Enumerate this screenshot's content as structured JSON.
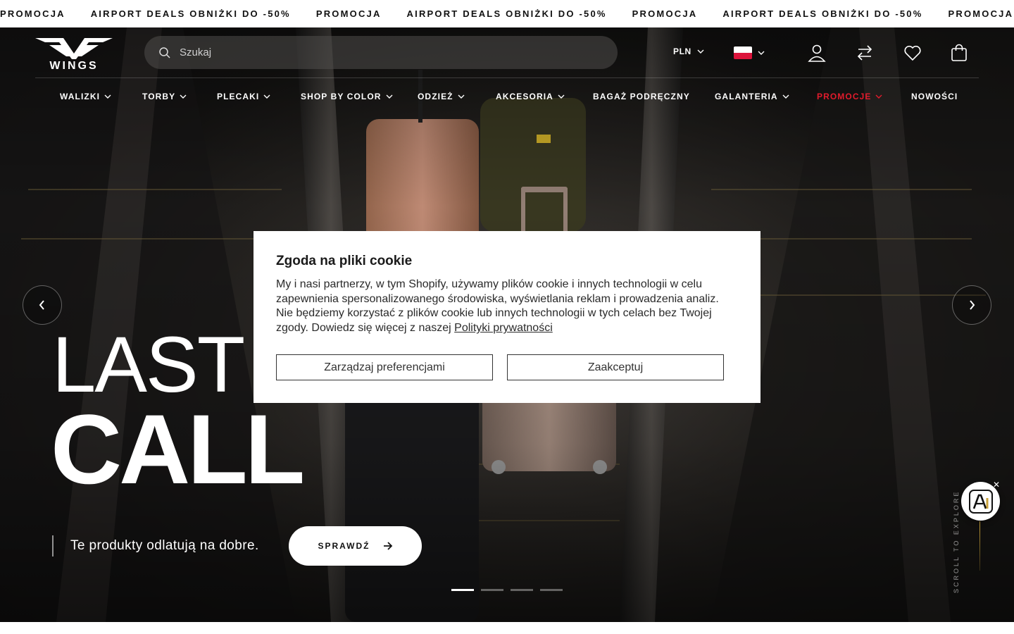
{
  "ticker": {
    "items": [
      "PROMOCJA",
      "AIRPORT DEALS OBNIŻKI DO -50%",
      "PROMOCJA",
      "AIRPORT DEALS OBNIŻKI DO -50%",
      "PROMOCJA",
      "AIRPORT DEALS OBNIŻKI DO -50%",
      "PROMOCJA"
    ]
  },
  "header": {
    "logo_text": "WINGS",
    "search_placeholder": "Szukaj",
    "currency": "PLN",
    "language_flag": "poland-flag-icon",
    "icons": [
      "user-icon",
      "compare-icon",
      "heart-icon",
      "cart-icon"
    ]
  },
  "nav": {
    "items": [
      {
        "label": "WALIZKI",
        "dropdown": true
      },
      {
        "label": "TORBY",
        "dropdown": true
      },
      {
        "label": "PLECAKI",
        "dropdown": true
      },
      {
        "label": "SHOP BY COLOR",
        "dropdown": true
      },
      {
        "label": "ODZIEŻ",
        "dropdown": true
      },
      {
        "label": "AKCESORIA",
        "dropdown": true
      },
      {
        "label": "BAGAŻ PODRĘCZNY",
        "dropdown": false
      },
      {
        "label": "GALANTERIA",
        "dropdown": true
      },
      {
        "label": "PROMOCJE",
        "dropdown": true
      },
      {
        "label": "NOWOŚCI",
        "dropdown": false
      }
    ]
  },
  "hero": {
    "title_line1": "LAST",
    "title_line2": "CALL",
    "tagline": "Te produkty odlatują na dobre.",
    "cta_label": "SPRAWDŹ",
    "slides_total": 4,
    "active_slide": 1,
    "scroll_hint": "SCROLL TO EXPLORE"
  },
  "cookie": {
    "title": "Zgoda na pliki cookie",
    "text": "My i nasi partnerzy, w tym Shopify, używamy plików cookie i innych technologii w celu zapewnienia spersonalizowanego środowiska, wyświetlania reklam i prowadzenia analiz. Nie będziemy korzystać z plików cookie lub innych technologii w tych celach bez Twojej zgody. Dowiedz się więcej z naszej ",
    "link_text": "Polityki prywatności",
    "manage_label": "Zarządzaj preferencjami",
    "accept_label": "Zaakceptuj"
  },
  "colors": {
    "accent_promo": "#e21b2c",
    "ai_accent": "#c9a23a"
  }
}
